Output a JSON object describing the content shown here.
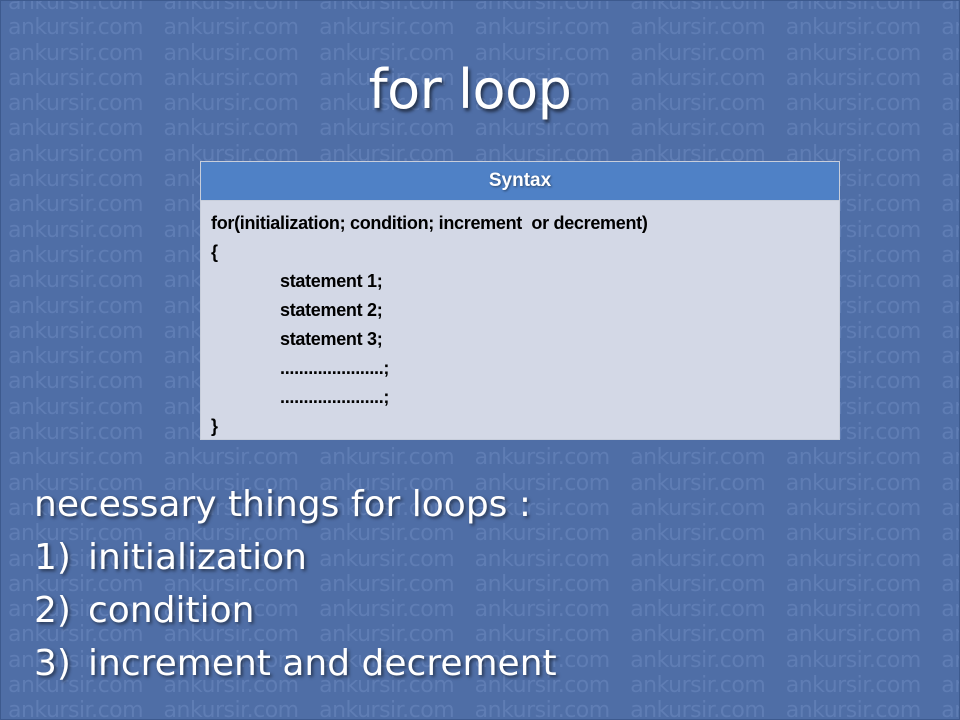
{
  "watermark": {
    "text": "ankursir.com"
  },
  "slide": {
    "title": "for loop"
  },
  "syntax": {
    "header": "Syntax",
    "lines": [
      "for(initialization; condition; increment  or decrement)",
      "{",
      "statement 1;",
      "statement 2;",
      "statement 3;",
      "......................;",
      "......................;",
      "}"
    ]
  },
  "notes": {
    "heading": "necessary things for loops :",
    "items": [
      {
        "number": "1)",
        "text": "initialization"
      },
      {
        "number": "2)",
        "text": "condition"
      },
      {
        "number": "3)",
        "text": "increment and decrement"
      }
    ]
  },
  "colors": {
    "background": "#4f6ea6",
    "watermark": "#5f7db4",
    "syntax_header": "#4f81c6",
    "syntax_body": "#d3d8e6",
    "text_light": "#ffffff"
  }
}
